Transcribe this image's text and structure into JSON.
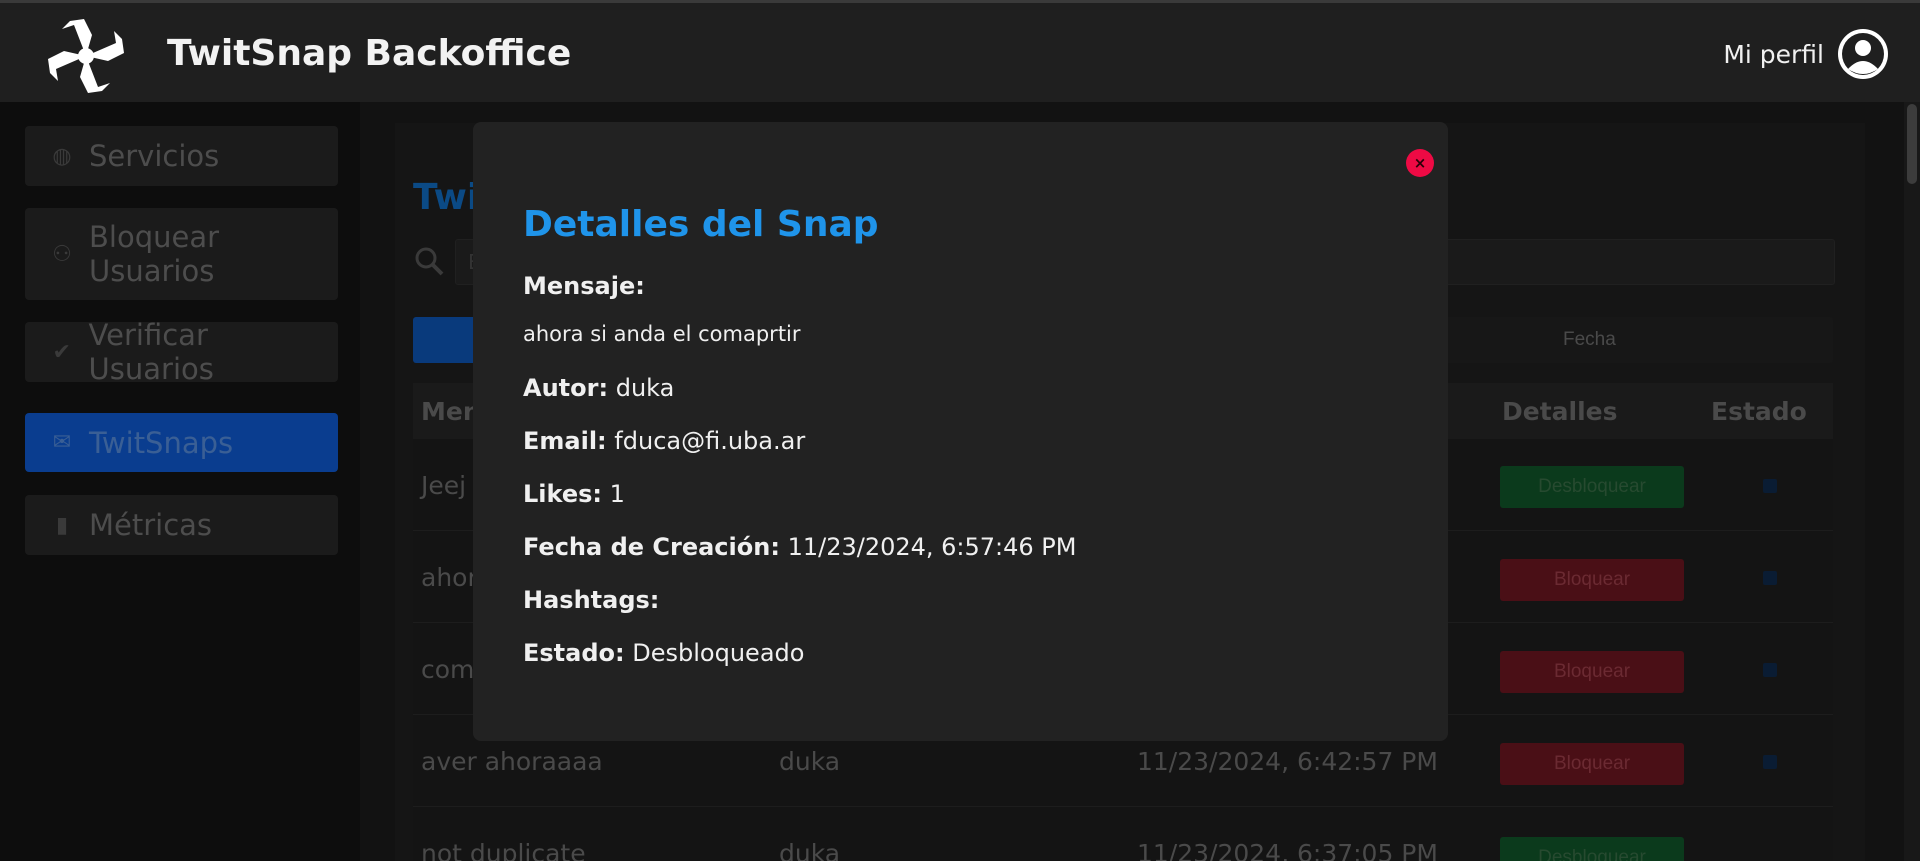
{
  "header": {
    "title": "TwitSnap Backoffice",
    "profile_label": "Mi perfil"
  },
  "sidebar": {
    "items": [
      {
        "label": "Servicios",
        "icon": "globe-icon"
      },
      {
        "label": "Bloquear Usuarios",
        "icon": "user-block-icon"
      },
      {
        "label": "Verificar Usuarios",
        "icon": "verified-icon"
      },
      {
        "label": "TwitSnaps",
        "icon": "envelope-icon",
        "active": true
      },
      {
        "label": "Métricas",
        "icon": "bar-chart-icon"
      }
    ]
  },
  "main": {
    "title": "Twi",
    "search_placeholder": "B",
    "filter_fecha": "Fecha",
    "columns": {
      "mensaje": "Men",
      "detalles": "Detalles",
      "estado": "Estado"
    },
    "rows": [
      {
        "mensaje": "Jeej",
        "autor": "",
        "fecha": "",
        "action": "Desbloquear"
      },
      {
        "mensaje": "ahor",
        "autor": "",
        "fecha": "",
        "action": "Bloquear"
      },
      {
        "mensaje": "com",
        "autor": "",
        "fecha": "",
        "action": "Bloquear"
      },
      {
        "mensaje": "aver ahoraaaa",
        "autor": "duka",
        "fecha": "11/23/2024, 6:42:57 PM",
        "action": "Bloquear"
      },
      {
        "mensaje": "not duplicate",
        "autor": "duka",
        "fecha": "11/23/2024, 6:37:05 PM",
        "action": "Desbloquear"
      }
    ]
  },
  "modal": {
    "close_label": "×",
    "title": "Detalles del Snap",
    "mensaje_label": "Mensaje:",
    "mensaje": "ahora si anda el comaprtir",
    "autor_label": "Autor:",
    "autor": "duka",
    "email_label": "Email:",
    "email": "fduca@fi.uba.ar",
    "likes_label": "Likes:",
    "likes": "1",
    "fecha_label": "Fecha de Creación:",
    "fecha": "11/23/2024, 6:57:46 PM",
    "hashtags_label": "Hashtags:",
    "hashtags": "",
    "estado_label": "Estado:",
    "estado": "Desbloqueado"
  },
  "colors": {
    "accent": "#1f94ea",
    "close": "#ee0a44",
    "unlock": "#0b3a1c",
    "lock": "#4a0f16"
  }
}
